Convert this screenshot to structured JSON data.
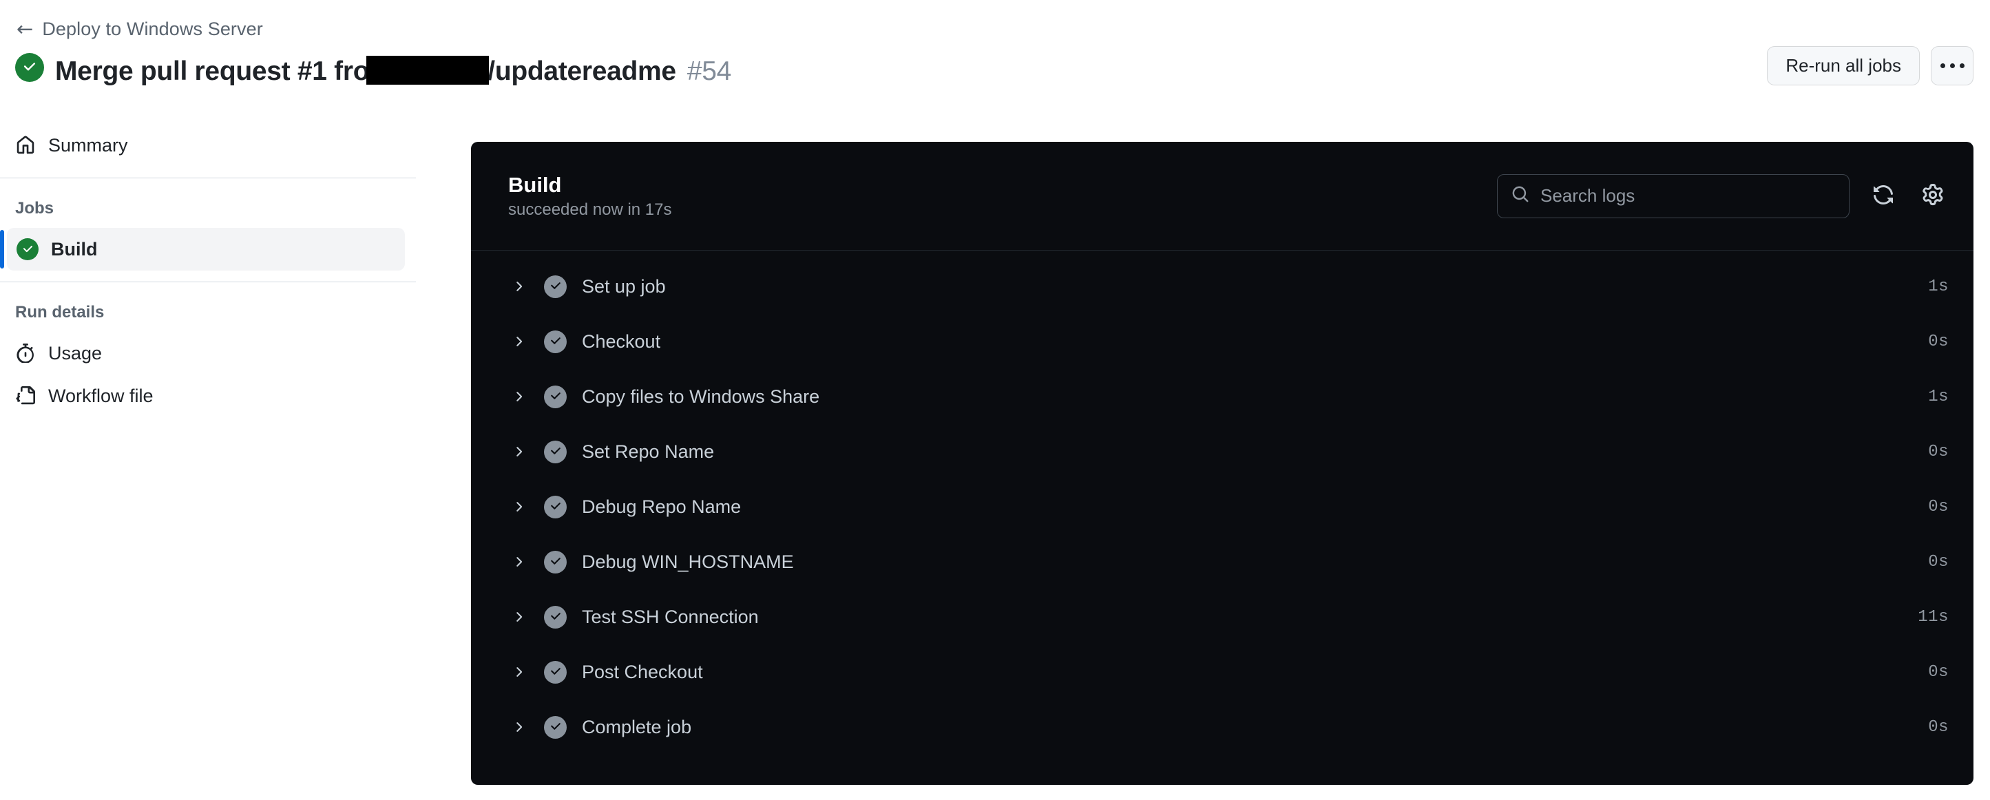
{
  "header": {
    "breadcrumb": {
      "back_icon": "arrow-left-icon",
      "label": "Deploy to Windows Server"
    },
    "status_icon": "check-circle-success-icon",
    "title_prefix": "Merge pull request #1 fro",
    "title_redacted": true,
    "title_suffix": "/updatereadme",
    "run_number": "#54",
    "actions": {
      "rerun_label": "Re-run all jobs",
      "kebab_icon": "kebab-horizontal-icon"
    }
  },
  "sidebar": {
    "summary": {
      "label": "Summary",
      "icon": "home-icon"
    },
    "jobs_heading": "Jobs",
    "jobs": [
      {
        "label": "Build",
        "status": "success",
        "icon": "check-circle-success-icon",
        "selected": true
      }
    ],
    "run_details_heading": "Run details",
    "run_details": [
      {
        "label": "Usage",
        "icon": "stopwatch-icon"
      },
      {
        "label": "Workflow file",
        "icon": "file-code-icon"
      }
    ]
  },
  "log_panel": {
    "job_title": "Build",
    "job_status": "succeeded now in 17s",
    "search": {
      "placeholder": "Search logs",
      "value": "",
      "icon": "search-icon"
    },
    "refresh_icon": "sync-icon",
    "settings_icon": "gear-icon",
    "steps": [
      {
        "name": "Set up job",
        "duration": "1s",
        "status": "success",
        "expanded": false
      },
      {
        "name": "Checkout",
        "duration": "0s",
        "status": "success",
        "expanded": false
      },
      {
        "name": "Copy files to Windows Share",
        "duration": "1s",
        "status": "success",
        "expanded": false
      },
      {
        "name": "Set Repo Name",
        "duration": "0s",
        "status": "success",
        "expanded": false
      },
      {
        "name": "Debug Repo Name",
        "duration": "0s",
        "status": "success",
        "expanded": false
      },
      {
        "name": "Debug WIN_HOSTNAME",
        "duration": "0s",
        "status": "success",
        "expanded": false
      },
      {
        "name": "Test SSH Connection",
        "duration": "11s",
        "status": "success",
        "expanded": false
      },
      {
        "name": "Post Checkout",
        "duration": "0s",
        "status": "success",
        "expanded": false
      },
      {
        "name": "Complete job",
        "duration": "0s",
        "status": "success",
        "expanded": false
      }
    ]
  },
  "colors": {
    "success_green": "#1a7f37",
    "accent_blue": "#0969da",
    "panel_bg": "#0a0c10",
    "step_check_gray": "#8b949e",
    "muted_text": "#59636e"
  }
}
